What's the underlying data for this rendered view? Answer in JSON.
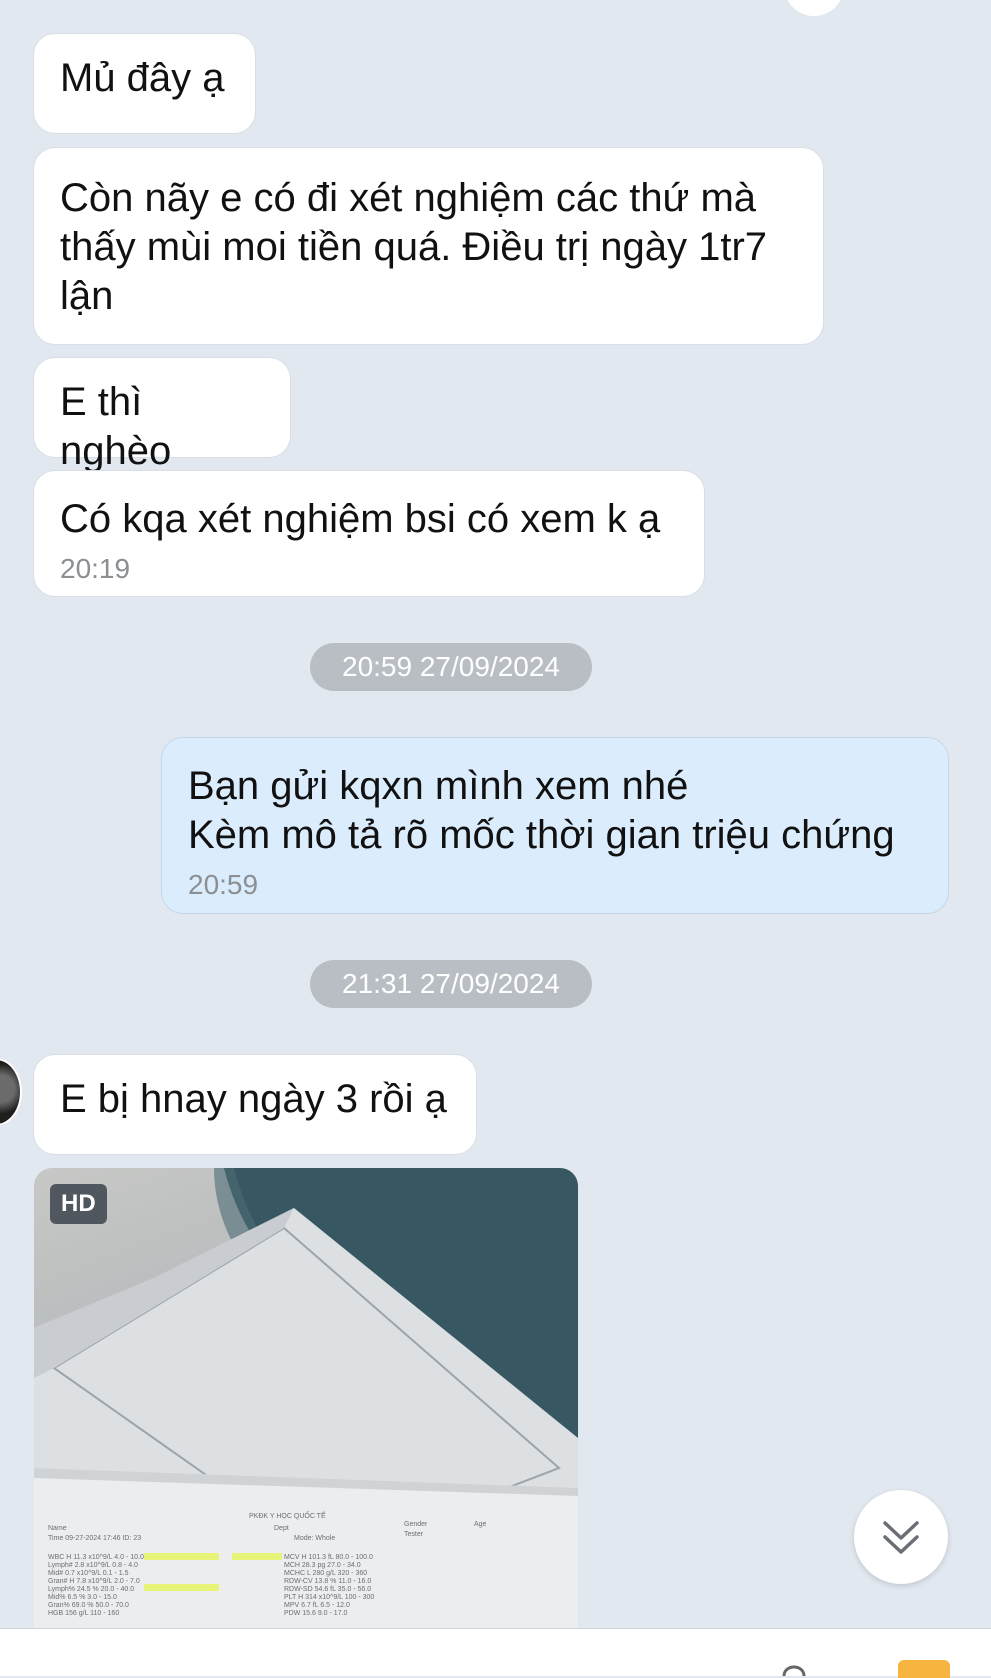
{
  "messages": [
    {
      "text": "Mủ đây ạ"
    },
    {
      "lines": [
        "Còn nãy e có đi xét nghiệm các thứ mà",
        "thấy mùi moi tiền quá. Điều trị ngày 1tr7",
        "lận"
      ]
    },
    {
      "text": "E thì nghèo"
    },
    {
      "text": "Có kqa xét nghiệm bsi có xem k ạ",
      "time": "20:19"
    }
  ],
  "separators": [
    "20:59 27/09/2024",
    "21:31 27/09/2024"
  ],
  "outgoing": {
    "lines": [
      "Bạn gửi kqxn mình xem nhé",
      "Kèm mô tả rõ mốc thời gian triệu chứng"
    ],
    "time": "20:59"
  },
  "incoming2": {
    "text": "E bị hnay ngày 3 rồi ạ"
  },
  "photo": {
    "badge": "HD",
    "report": {
      "clinic": "PKĐK Y HỌC QUỐC TẾ",
      "name_label": "Name",
      "time_line": "Time 09-27-2024 17:46  ID: 23",
      "mode": "Mode: Whole",
      "dept": "Dept",
      "gender": "Gender",
      "age": "Age",
      "tester": "Tester",
      "rows_left": [
        "WBC  H 11.3 x10^9/L  4.0 - 10.0",
        "Lymph#  2.8 x10^9/L  0.8 - 4.0",
        "Mid#  0.7 x10^9/L  0.1 - 1.5",
        "Gran#  H 7.8 x10^9/L  2.0 - 7.0",
        "Lymph%  24.5 %  20.0 - 40.0",
        "Mid%  6.5 %  3.0 - 15.0",
        "Gran%  69.0 %  50.0 - 70.0",
        "HGB  156 g/L  110 - 160"
      ],
      "rows_right": [
        "MCV  H 101.3 fL  80.0 - 100.0",
        "MCH  28.3 pg  27.0 - 34.0",
        "MCHC  L 280 g/L  320 - 360",
        "RDW-CV  13.8 %  11.0 - 16.0",
        "RDW-SD  54.6 fL  35.0 - 56.0",
        "PLT  H 314 x10^9/L  100 - 300",
        "MPV  6.7 fL  6.5 - 12.0",
        "PDW  15.6  9.0 - 17.0"
      ]
    }
  },
  "icons": {
    "scroll": "double-chevron-down-icon"
  }
}
